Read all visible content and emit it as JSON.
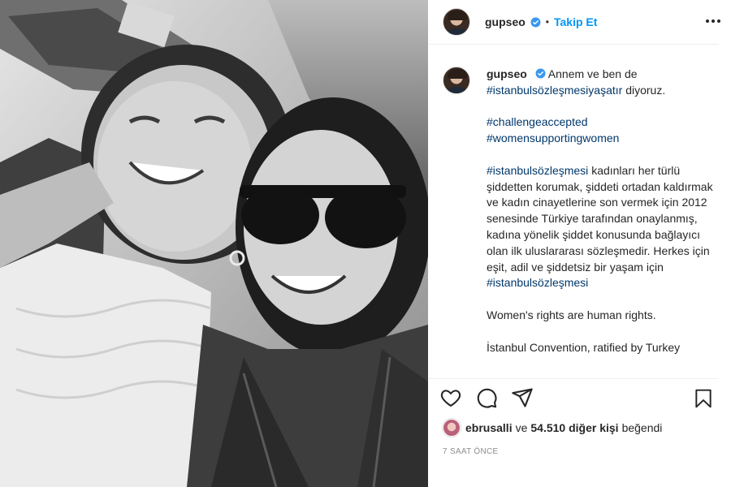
{
  "post": {
    "username": "gupseo",
    "follow_label": "Takip Et",
    "separator": "•"
  },
  "caption": {
    "intro": "Annem ve ben de",
    "tag1": "#istanbulsözleşmesiyaşatır",
    "intro_end": "diyoruz.",
    "tag2": "#challengeaccepted",
    "tag3": "#womensupportingwomen",
    "tag4": "#istanbulsözleşmesi",
    "body": "kadınları her türlü şiddetten korumak, şiddeti ortadan kaldırmak ve kadın cinayetlerine son vermek için 2012 senesinde Türkiye tarafından onaylanmış, kadına yönelik şiddet konusunda bağlayıcı olan ilk uluslararası sözleşmedir. Herkes için eşit, adil ve şiddetsiz bir yaşam için",
    "tag5": "#istanbulsözleşmesi",
    "english1": "Women's rights are human rights.",
    "english2": "İstanbul Convention, ratified by Turkey"
  },
  "likes": {
    "first_user": "ebrusalli",
    "conjunction": "ve",
    "count": "54.510 diğer kişi",
    "suffix": "beğendi"
  },
  "timestamp": "7 SAAT ÖNCE",
  "colors": {
    "link_blue": "#0095f6",
    "hashtag": "#00376b",
    "verified": "#3897f0",
    "muted": "#8e8e8e",
    "border": "#efefef"
  },
  "icons": [
    "more-options-icon",
    "verified-badge-icon",
    "heart-icon",
    "comment-icon",
    "share-icon",
    "bookmark-icon"
  ]
}
